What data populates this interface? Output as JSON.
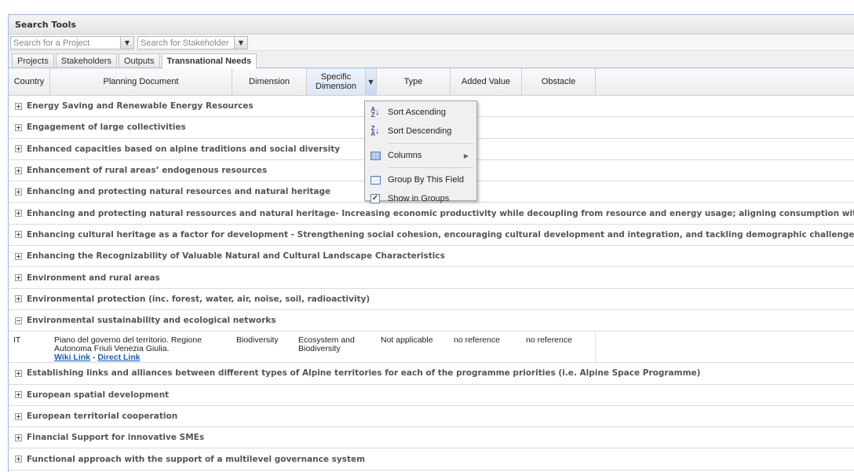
{
  "panel": {
    "title": "Search Tools"
  },
  "search": {
    "project_placeholder": "Search for a Project",
    "stakeholder_placeholder": "Search for Stakeholder"
  },
  "tabs": [
    {
      "label": "Projects",
      "active": false
    },
    {
      "label": "Stakeholders",
      "active": false
    },
    {
      "label": "Outputs",
      "active": false
    },
    {
      "label": "Transnational Needs",
      "active": true
    }
  ],
  "columns": [
    {
      "label": "Country"
    },
    {
      "label": "Planning Document"
    },
    {
      "label": "Dimension"
    },
    {
      "label": "Specific Dimension"
    },
    {
      "label": "Type"
    },
    {
      "label": "Added Value"
    },
    {
      "label": "Obstacle"
    }
  ],
  "groups_before": [
    "Energy Saving and Renewable Energy Resources",
    "Engagement of large collectivities",
    "Enhanced capacities based on alpine traditions and social diversity",
    "Enhancement of rural areas’ endogenous resources",
    "Enhancing and protecting natural resources and natural heritage",
    "Enhancing and protecting natural ressources and natural heritage- Increasing economic productivity while decoupling from resource and energy usage; aligning consumption with sustainable development",
    "Enhancing cultural heritage as a factor for development - Strengthening social cohesion, encouraging cultural development and integration, and tackling demographic challenges at an early stage",
    "Enhancing the Recognizability of Valuable Natural and Cultural Landscape Characteristics",
    "Environment and rural areas",
    "Environmental protection (inc. forest, water, air, noise, soil, radioactivity)"
  ],
  "expanded_group": {
    "label": "Environmental sustainability and ecological networks",
    "row": {
      "country": "IT",
      "planning_document_line1": "Piano del governo del territorio. Regione",
      "planning_document_line2": "Autonoma Friuli Venezia Giulia.",
      "wiki_link": "Wiki Link",
      "link_separator": " - ",
      "direct_link": "Direct Link",
      "dimension": "Biodiversity",
      "specific_dimension_line1": "Ecosystem and",
      "specific_dimension_line2": "Biodiversity",
      "type": "Not applicable",
      "added_value": "no reference",
      "obstacle": "no reference"
    }
  },
  "groups_after": [
    "Establishing links and alliances between different types of Alpine territories for each of the programme priorities (i.e. Alpine Space Programme)",
    "European spatial development",
    "European territorial cooperation",
    "Financial Support for innovative SMEs",
    "Functional approach with the support of a multilevel governance system"
  ],
  "column_menu": {
    "sort_ascending": "Sort Ascending",
    "sort_descending": "Sort Descending",
    "columns": "Columns",
    "group_by": "Group By This Field",
    "show_in_groups": "Show in Groups",
    "show_in_groups_checked": true
  },
  "icons": {
    "collapsed": "plus-box-icon",
    "expanded": "minus-box-icon"
  }
}
